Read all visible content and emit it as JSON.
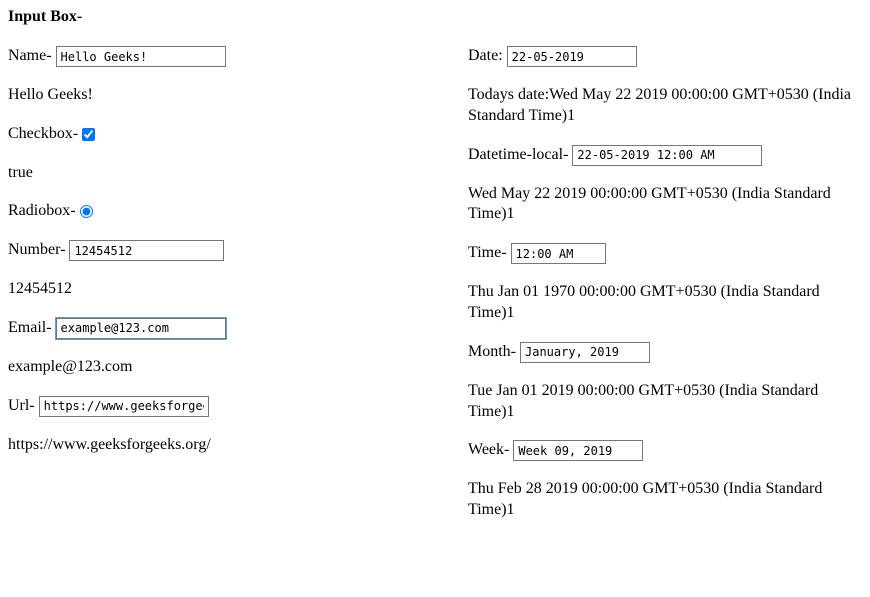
{
  "heading": "Input Box-",
  "left": {
    "name": {
      "label": "Name- ",
      "value": "Hello Geeks!",
      "echo": "Hello Geeks!"
    },
    "checkbox": {
      "label": "Checkbox- ",
      "checked": true,
      "echo": "true"
    },
    "radio": {
      "label": "Radiobox- ",
      "checked": true
    },
    "number": {
      "label": "Number- ",
      "value": "12454512",
      "echo": "12454512"
    },
    "email": {
      "label": "Email- ",
      "value": "example@123.com",
      "echo": "example@123.com"
    },
    "url": {
      "label": "Url- ",
      "value": "https://www.geeksforgeeks.o",
      "echo": "https://www.geeksforgeeks.org/"
    }
  },
  "right": {
    "date": {
      "label": "Date: ",
      "value": "22-05-2019",
      "echo": "Todays date:Wed May 22 2019 00:00:00 GMT+0530 (India Standard Time)1"
    },
    "datetime": {
      "label": "Datetime-local- ",
      "value": "22-05-2019 12:00 AM",
      "echo": "Wed May 22 2019 00:00:00 GMT+0530 (India Standard Time)1"
    },
    "time": {
      "label": "Time- ",
      "value": "12:00 AM",
      "echo": "Thu Jan 01 1970 00:00:00 GMT+0530 (India Standard Time)1"
    },
    "month": {
      "label": "Month- ",
      "value": "January, 2019",
      "echo": "Tue Jan 01 2019 00:00:00 GMT+0530 (India Standard Time)1"
    },
    "week": {
      "label": "Week- ",
      "value": "Week 09, 2019",
      "echo": "Thu Feb 28 2019 00:00:00 GMT+0530 (India Standard Time)1"
    }
  }
}
